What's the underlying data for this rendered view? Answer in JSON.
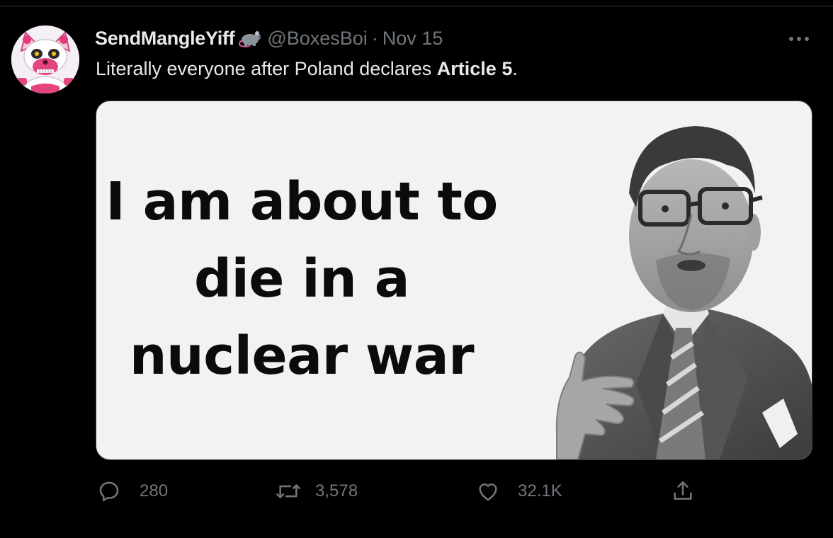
{
  "tweet": {
    "display_name": "SendMangleYiff",
    "name_emoji": "rat-icon",
    "handle": "@BoxesBoi",
    "separator": "·",
    "date": "Nov 15",
    "text_prefix": "Literally everyone after Poland declares ",
    "text_bold": "Article 5",
    "text_suffix": ".",
    "avatar": "funtime-foxy-avatar",
    "media": {
      "caption_lines": [
        "I am about to",
        "die in a",
        "nuclear war"
      ],
      "subject": "man-in-suit-photo"
    },
    "actions": {
      "replies": "280",
      "retweets": "3,578",
      "likes": "32.1K"
    }
  },
  "colors": {
    "background": "#000000",
    "primary_text": "#e7e9ea",
    "secondary_text": "#71767b",
    "border": "#2f3336"
  }
}
